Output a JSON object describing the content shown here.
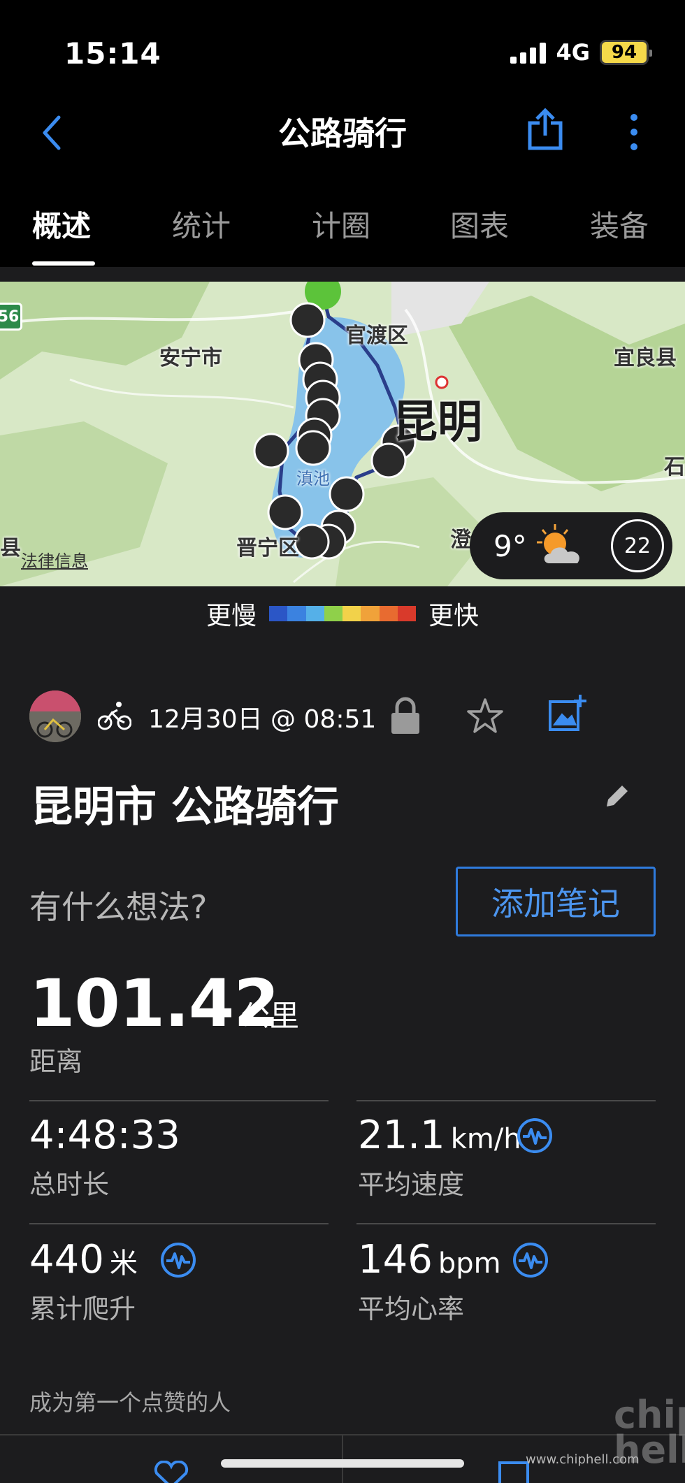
{
  "status_bar": {
    "time": "15:14",
    "network": "4G",
    "battery": "94"
  },
  "header": {
    "title": "公路骑行"
  },
  "tabs": [
    {
      "label": "概述",
      "active": true
    },
    {
      "label": "统计",
      "active": false
    },
    {
      "label": "计圈",
      "active": false
    },
    {
      "label": "图表",
      "active": false
    },
    {
      "label": "装备",
      "active": false
    }
  ],
  "map": {
    "labels": [
      "官渡区",
      "安宁市",
      "宜良县",
      "昆明",
      "滇池",
      "晋宁区",
      "澄",
      "石",
      "县"
    ],
    "road_badge": "56",
    "legal": "法律信息",
    "weather": {
      "temp": "9°",
      "wind": "22",
      "icon": "partly-cloudy-sun-icon"
    }
  },
  "speed_legend": {
    "slow": "更慢",
    "fast": "更快",
    "colors": [
      "#2b56c6",
      "#3b82e0",
      "#55b0e8",
      "#8fd04a",
      "#f2d24a",
      "#f0a23a",
      "#e86b30",
      "#d93a2b"
    ]
  },
  "activity": {
    "date": "12月30日 @ 08:51",
    "title": "昆明市 公路骑行",
    "thoughts_prompt": "有什么想法?",
    "add_note": "添加笔记"
  },
  "distance": {
    "value": "101.42",
    "unit": "公里",
    "label": "距离"
  },
  "stats": [
    {
      "value": "4:48:33",
      "unit": "",
      "label": "总时长",
      "has_icon": false
    },
    {
      "value": "21.1",
      "unit": "km/h",
      "label": "平均速度",
      "has_icon": true
    },
    {
      "value": "440",
      "unit": "米",
      "label": "累计爬升",
      "has_icon": true
    },
    {
      "value": "146",
      "unit": "bpm",
      "label": "平均心率",
      "has_icon": true
    }
  ],
  "likes": {
    "text": "成为第一个点赞的人"
  },
  "watermark": {
    "text": "chip\nhell",
    "url": "www.chiphell.com"
  },
  "colors": {
    "accent": "#2f7bdd",
    "background": "#1c1c1e",
    "header": "#000000"
  }
}
